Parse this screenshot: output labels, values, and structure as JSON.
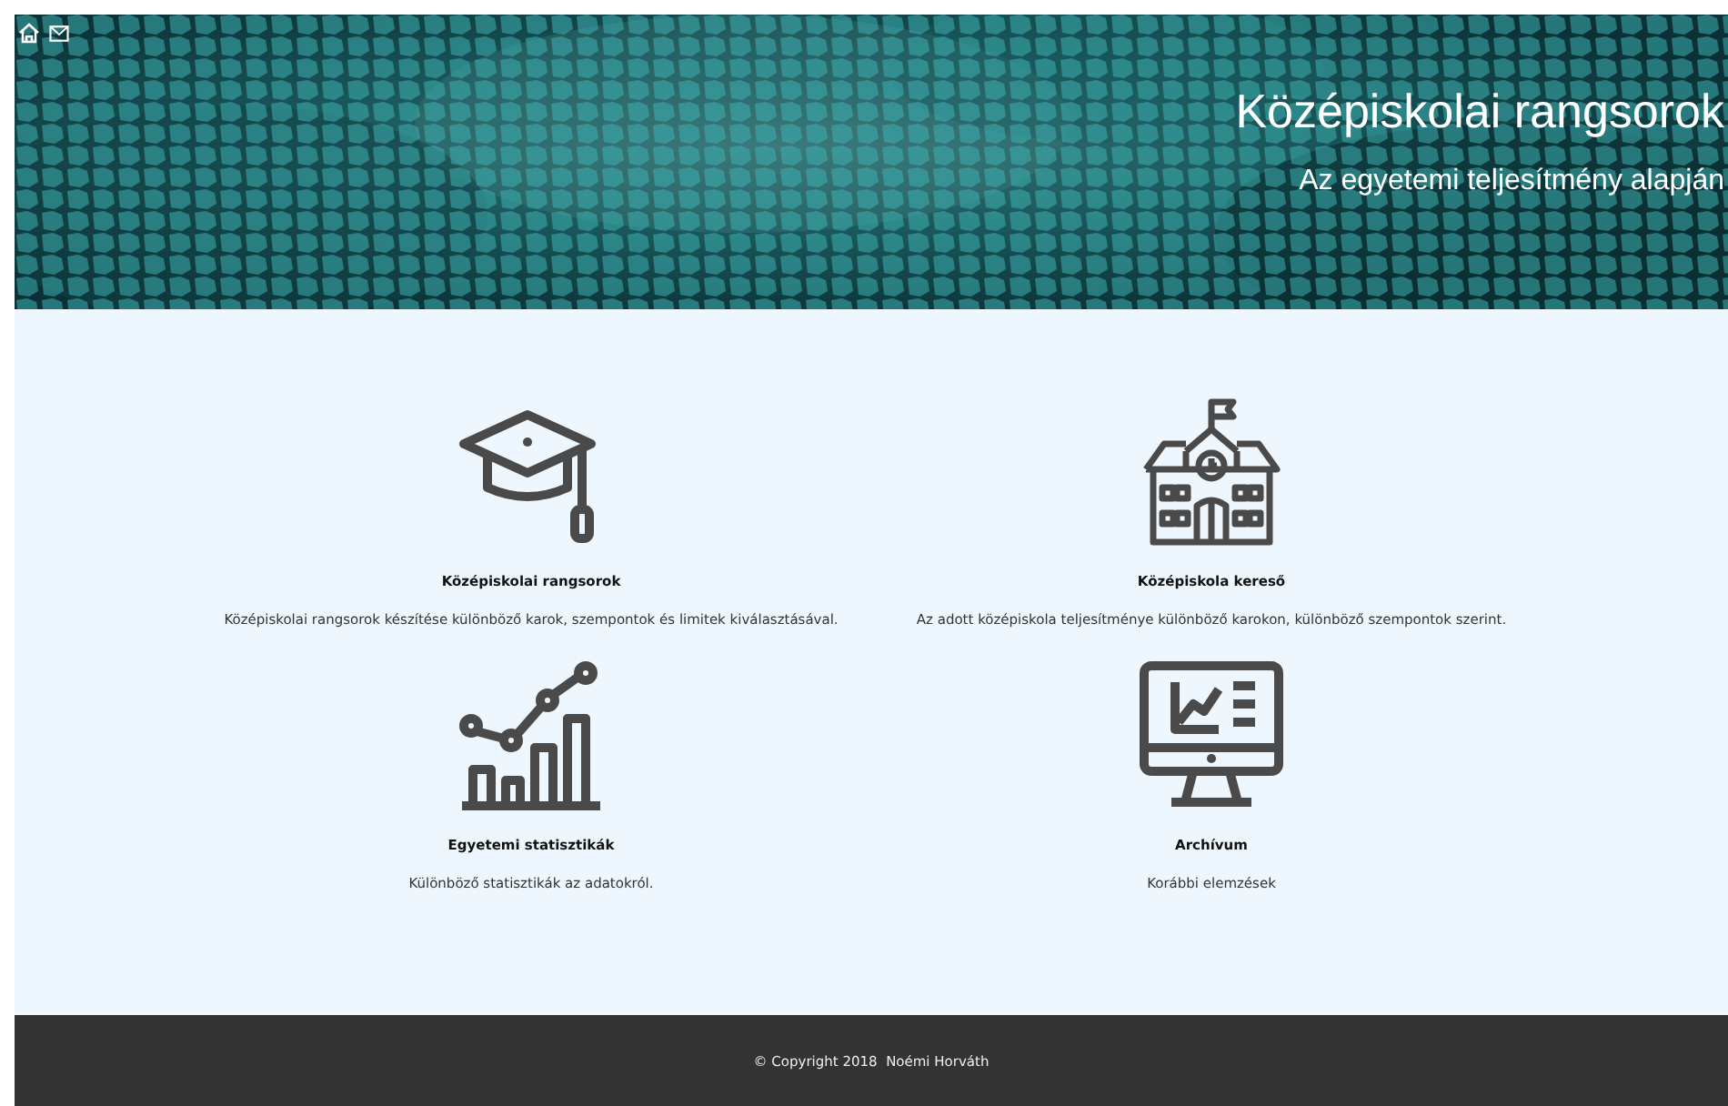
{
  "nav": [
    {
      "kind": "home"
    },
    {
      "kind": "mail"
    }
  ],
  "banner": {
    "title": "Középiskolai rangsorok",
    "subtitle": "Az egyetemi teljesítmény alapján"
  },
  "features": [
    {
      "kind": "cap",
      "title": "Középiskolai rangsorok",
      "description": "Középiskolai rangsorok készítése különböző karok, szempontok és limitek kiválasztásával."
    },
    {
      "kind": "school",
      "title": "Középiskola kereső",
      "description": "Az adott középiskola teljesítménye különböző karokon, különböző szempontok szerint."
    },
    {
      "kind": "stats",
      "title": "Egyetemi statisztikák",
      "description": "Különböző statisztikák az adatokról."
    },
    {
      "kind": "monitor",
      "title": "Archívum",
      "description": "Korábbi elemzések"
    }
  ],
  "footer": "© Copyright 2018  Noémi Horváth"
}
